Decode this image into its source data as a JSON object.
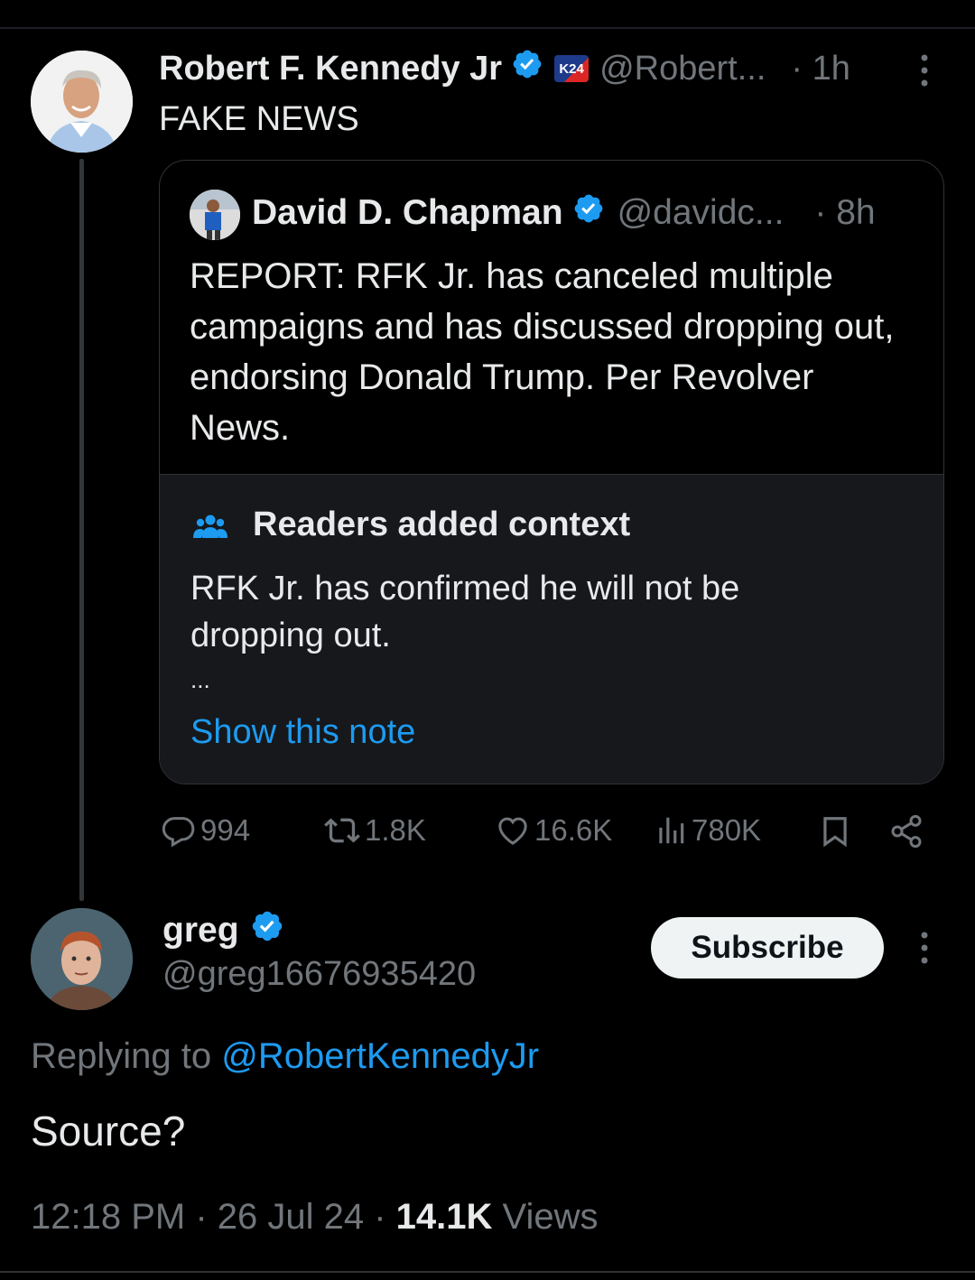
{
  "main_tweet": {
    "author_name": "Robert F. Kennedy Jr",
    "handle": "@Robert...",
    "time": "· 1h",
    "badge_text": "K24",
    "text": "FAKE NEWS"
  },
  "quoted_tweet": {
    "author_name": "David D. Chapman",
    "handle": "@davidc...",
    "time": "· 8h",
    "text": "REPORT: RFK Jr. has canceled multiple campaigns and has discussed dropping out, endorsing Donald Trump. Per Revolver News."
  },
  "community_note": {
    "title": "Readers added context",
    "text": "RFK Jr. has confirmed he will not be dropping out.",
    "ellipsis": "...",
    "link_label": "Show this note"
  },
  "actions": {
    "replies": "994",
    "reposts": "1.8K",
    "likes": "16.6K",
    "views": "780K"
  },
  "reply": {
    "author_name": "greg",
    "handle": "@greg16676935420",
    "subscribe_label": "Subscribe",
    "replying_prefix": "Replying to ",
    "replying_handle": "@RobertKennedyJr",
    "text": "Source?",
    "time": "12:18 PM · 26 Jul 24 · ",
    "views_count": "14.1K",
    "views_label": " Views"
  },
  "colors": {
    "accent": "#1d9bf0",
    "muted": "#71767b",
    "background": "#000000",
    "note_background": "#16181c"
  }
}
